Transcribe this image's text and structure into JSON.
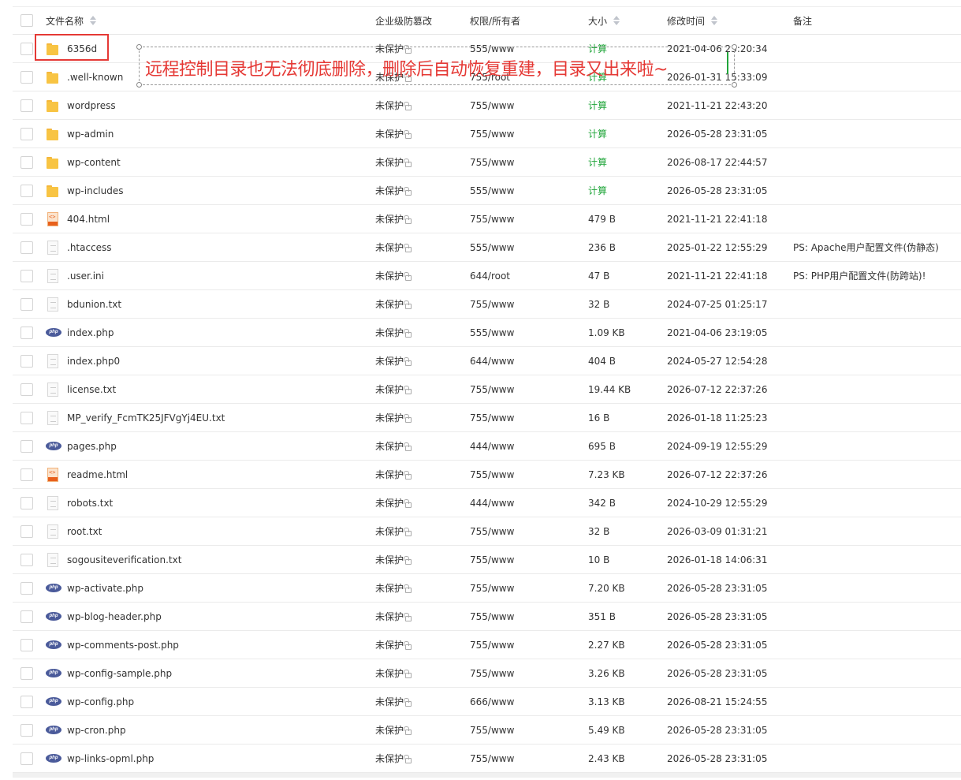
{
  "header": {
    "name": "文件名称",
    "protect": "企业级防篡改",
    "perm": "权限/所有者",
    "size": "大小",
    "mtime": "修改时间",
    "note": "备注"
  },
  "annotation": "远程控制目录也无法彻底删除，删除后自动恢复重建，目录又出来啦~",
  "files": [
    {
      "name": "6356d",
      "type": "folder",
      "protect": "未保护",
      "perm": "555/www",
      "size": "计算",
      "time": "2021-04-06 23:20:34",
      "note": ""
    },
    {
      "name": ".well-known",
      "type": "folder",
      "protect": "未保护",
      "perm": "755/root",
      "size": "计算",
      "time": "2026-01-31 15:33:09",
      "note": ""
    },
    {
      "name": "wordpress",
      "type": "folder",
      "protect": "未保护",
      "perm": "755/www",
      "size": "计算",
      "time": "2021-11-21 22:43:20",
      "note": ""
    },
    {
      "name": "wp-admin",
      "type": "folder",
      "protect": "未保护",
      "perm": "755/www",
      "size": "计算",
      "time": "2026-05-28 23:31:05",
      "note": ""
    },
    {
      "name": "wp-content",
      "type": "folder",
      "protect": "未保护",
      "perm": "755/www",
      "size": "计算",
      "time": "2026-08-17 22:44:57",
      "note": ""
    },
    {
      "name": "wp-includes",
      "type": "folder",
      "protect": "未保护",
      "perm": "555/www",
      "size": "计算",
      "time": "2026-05-28 23:31:05",
      "note": ""
    },
    {
      "name": "404.html",
      "type": "html",
      "protect": "未保护",
      "perm": "755/www",
      "size": "479 B",
      "time": "2021-11-21 22:41:18",
      "note": ""
    },
    {
      "name": ".htaccess",
      "type": "text",
      "protect": "未保护",
      "perm": "555/www",
      "size": "236 B",
      "time": "2025-01-22 12:55:29",
      "note": "PS: Apache用户配置文件(伪静态)"
    },
    {
      "name": ".user.ini",
      "type": "text",
      "protect": "未保护",
      "perm": "644/root",
      "size": "47 B",
      "time": "2021-11-21 22:41:18",
      "note": "PS: PHP用户配置文件(防跨站)!"
    },
    {
      "name": "bdunion.txt",
      "type": "text",
      "protect": "未保护",
      "perm": "755/www",
      "size": "32 B",
      "time": "2024-07-25 01:25:17",
      "note": ""
    },
    {
      "name": "index.php",
      "type": "php",
      "protect": "未保护",
      "perm": "555/www",
      "size": "1.09 KB",
      "time": "2021-04-06 23:19:05",
      "note": ""
    },
    {
      "name": "index.php0",
      "type": "text",
      "protect": "未保护",
      "perm": "644/www",
      "size": "404 B",
      "time": "2024-05-27 12:54:28",
      "note": ""
    },
    {
      "name": "license.txt",
      "type": "text",
      "protect": "未保护",
      "perm": "755/www",
      "size": "19.44 KB",
      "time": "2026-07-12 22:37:26",
      "note": ""
    },
    {
      "name": "MP_verify_FcmTK25JFVgYj4EU.txt",
      "type": "text",
      "protect": "未保护",
      "perm": "755/www",
      "size": "16 B",
      "time": "2026-01-18 11:25:23",
      "note": ""
    },
    {
      "name": "pages.php",
      "type": "php",
      "protect": "未保护",
      "perm": "444/www",
      "size": "695 B",
      "time": "2024-09-19 12:55:29",
      "note": ""
    },
    {
      "name": "readme.html",
      "type": "html",
      "protect": "未保护",
      "perm": "755/www",
      "size": "7.23 KB",
      "time": "2026-07-12 22:37:26",
      "note": ""
    },
    {
      "name": "robots.txt",
      "type": "text",
      "protect": "未保护",
      "perm": "444/www",
      "size": "342 B",
      "time": "2024-10-29 12:55:29",
      "note": ""
    },
    {
      "name": "root.txt",
      "type": "text",
      "protect": "未保护",
      "perm": "755/www",
      "size": "32 B",
      "time": "2026-03-09 01:31:21",
      "note": ""
    },
    {
      "name": "sogousiteverification.txt",
      "type": "text",
      "protect": "未保护",
      "perm": "755/www",
      "size": "10 B",
      "time": "2026-01-18 14:06:31",
      "note": ""
    },
    {
      "name": "wp-activate.php",
      "type": "php",
      "protect": "未保护",
      "perm": "755/www",
      "size": "7.20 KB",
      "time": "2026-05-28 23:31:05",
      "note": ""
    },
    {
      "name": "wp-blog-header.php",
      "type": "php",
      "protect": "未保护",
      "perm": "755/www",
      "size": "351 B",
      "time": "2026-05-28 23:31:05",
      "note": ""
    },
    {
      "name": "wp-comments-post.php",
      "type": "php",
      "protect": "未保护",
      "perm": "755/www",
      "size": "2.27 KB",
      "time": "2026-05-28 23:31:05",
      "note": ""
    },
    {
      "name": "wp-config-sample.php",
      "type": "php",
      "protect": "未保护",
      "perm": "755/www",
      "size": "3.26 KB",
      "time": "2026-05-28 23:31:05",
      "note": ""
    },
    {
      "name": "wp-config.php",
      "type": "php",
      "protect": "未保护",
      "perm": "666/www",
      "size": "3.13 KB",
      "time": "2026-08-21 15:24:55",
      "note": ""
    },
    {
      "name": "wp-cron.php",
      "type": "php",
      "protect": "未保护",
      "perm": "755/www",
      "size": "5.49 KB",
      "time": "2026-05-28 23:31:05",
      "note": ""
    },
    {
      "name": "wp-links-opml.php",
      "type": "php",
      "protect": "未保护",
      "perm": "755/www",
      "size": "2.43 KB",
      "time": "2026-05-28 23:31:05",
      "note": ""
    }
  ],
  "colors": {
    "accent": "#20a53a",
    "annotation": "#e53935",
    "folder": "#f8c443"
  },
  "icons": {
    "folder": "folder-icon",
    "text": "text-file-icon",
    "html": "html-file-icon",
    "php": "php-file-icon",
    "lock": "lock-icon"
  }
}
